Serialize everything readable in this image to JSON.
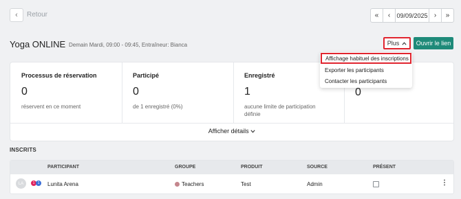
{
  "nav": {
    "back_label": "Retour",
    "first_icon": "double-chevron-left-icon",
    "prev_icon": "chevron-left-icon",
    "date": "09/09/2025",
    "next_icon": "chevron-right-icon",
    "last_icon": "double-chevron-right-icon"
  },
  "course": {
    "title": "Yoga ONLINE",
    "subtitle": "Demain Mardi, 09:00 - 09:45, Entraîneur: Bianca"
  },
  "actions": {
    "plus_label": "Plus",
    "open_label": "Ouvrir le lien"
  },
  "dropdown": {
    "items": [
      "Affichage habituel des inscriptions",
      "Exporter les participants",
      "Contacter les participants"
    ]
  },
  "stats": [
    {
      "label": "Processus de réservation",
      "value": "0",
      "note": "réservent en ce moment"
    },
    {
      "label": "Participé",
      "value": "0",
      "note": "de 1 enregistré (0%)"
    },
    {
      "label": "Enregistré",
      "value": "1",
      "note": "aucune limite de participation définie"
    },
    {
      "label": "",
      "value": "0",
      "note": ""
    }
  ],
  "details_label": "Afficher détails",
  "section_title": "INSCRITS",
  "table": {
    "headers": [
      "PARTICIPANT",
      "GROUPE",
      "PRODUIT",
      "SOURCE",
      "PRÉSENT"
    ],
    "rows": [
      {
        "initials": "LA",
        "badge1": "1",
        "badge2": "1",
        "participant": "Lunita Arena",
        "group": "Teachers",
        "product": "Test",
        "source": "Admin",
        "present": false
      }
    ]
  },
  "colors": {
    "accent": "#1e8a79",
    "highlight": "#e0242e",
    "group_dot": "#c4868d",
    "badge1": "#e0245e",
    "badge2": "#3b6fd8"
  }
}
